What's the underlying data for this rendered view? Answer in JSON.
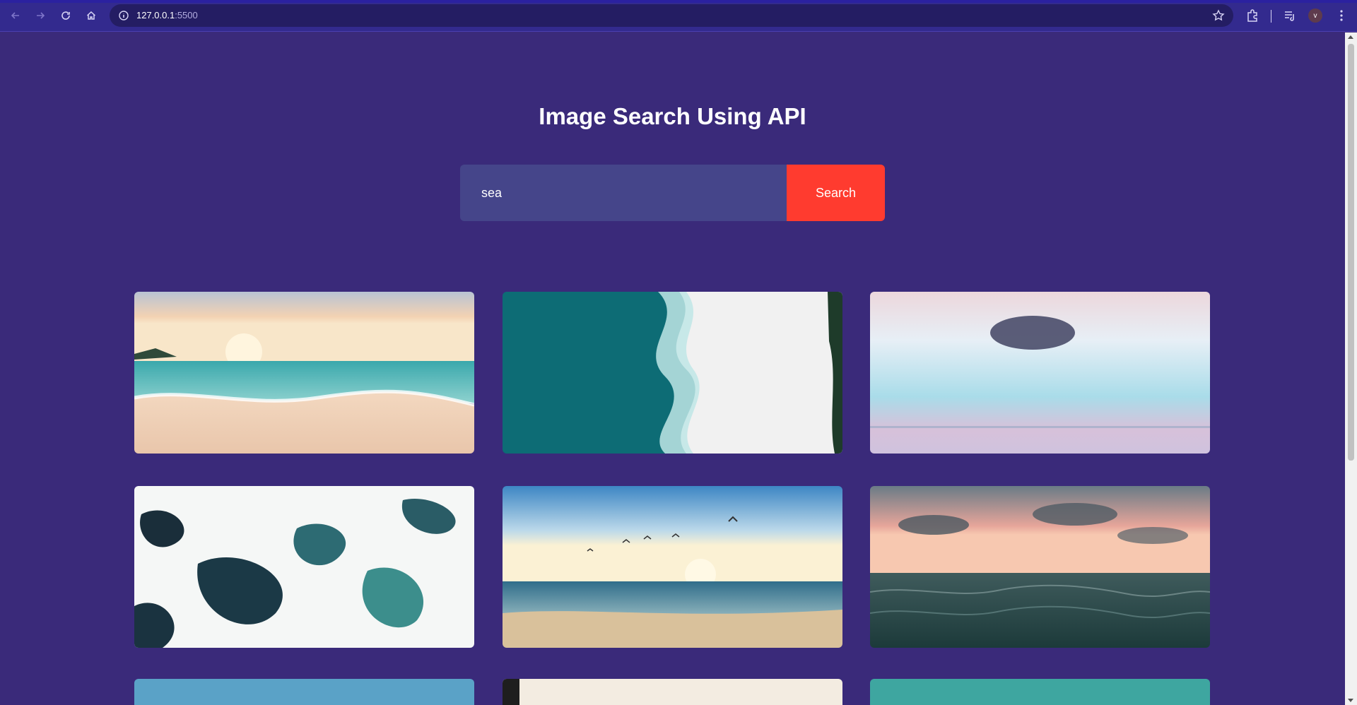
{
  "browser": {
    "url_host": "127.0.0.1",
    "url_port": ":5500",
    "avatar_letter": "v"
  },
  "page": {
    "title": "Image Search Using API",
    "search": {
      "value": "sea",
      "button_label": "Search"
    },
    "results": [
      {
        "name": "sunset-beach-waves"
      },
      {
        "name": "aerial-wave-sand"
      },
      {
        "name": "pastel-sky-cloud"
      },
      {
        "name": "white-foam-water"
      },
      {
        "name": "birds-over-beach"
      },
      {
        "name": "pink-sunset-ocean"
      },
      {
        "name": "blue-sky-partial"
      },
      {
        "name": "bright-haze-partial"
      },
      {
        "name": "teal-water-partial"
      }
    ]
  }
}
